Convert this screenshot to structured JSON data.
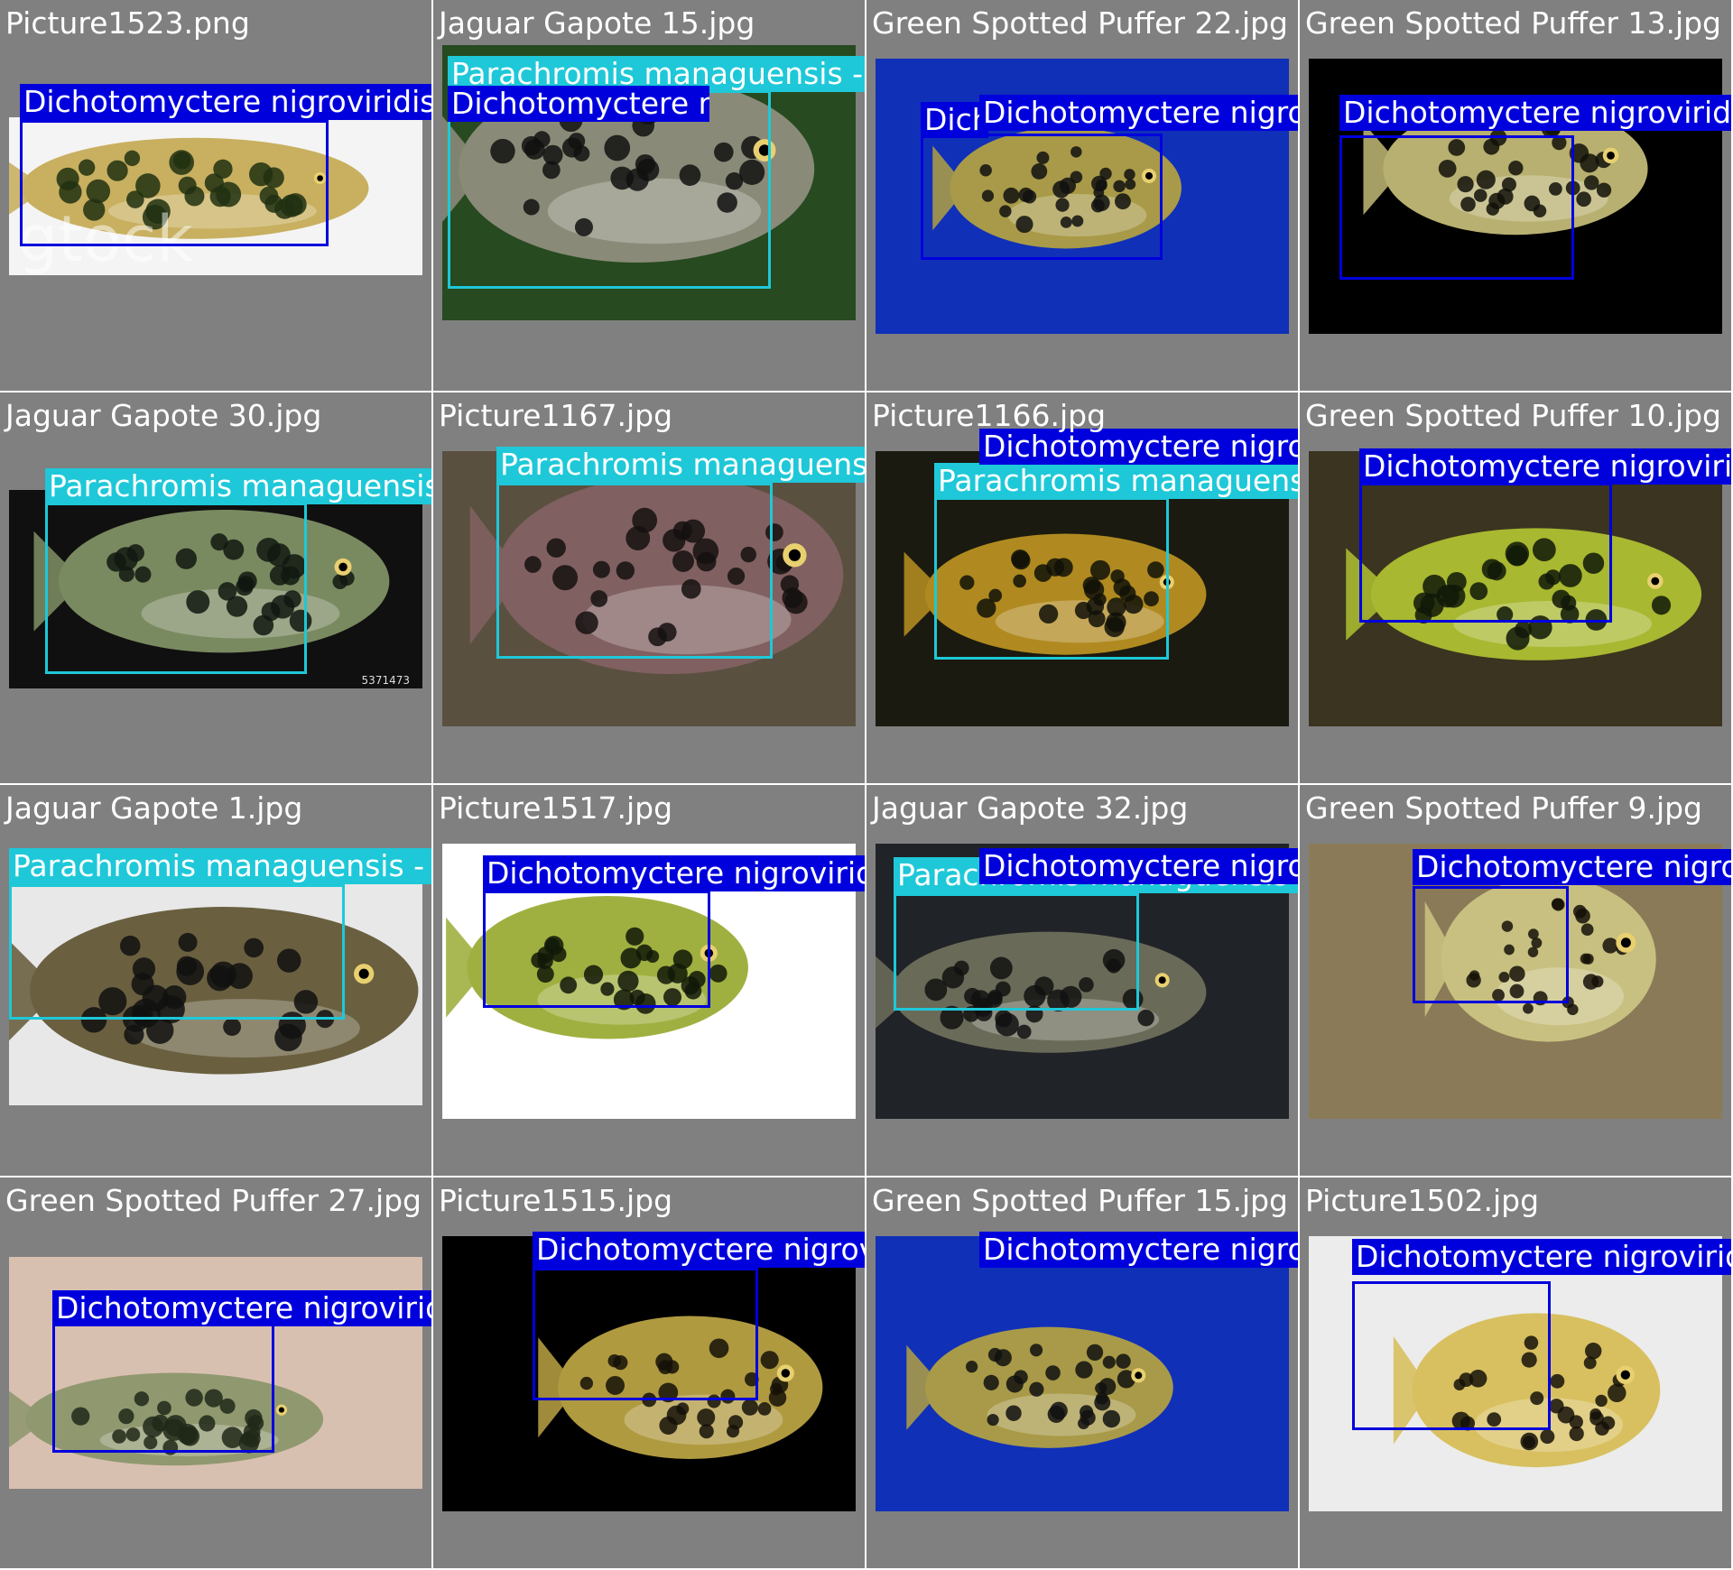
{
  "colors": {
    "grid_bg": "#808080",
    "cell_title": "#ffffff",
    "puffer": "#0000dd",
    "jaguar": "#1ec8d8",
    "label_text": "#ffffff"
  },
  "classes": {
    "puffer": "Dichotomyctere nigroviridis - Green Spotted Puffer",
    "jaguar": "Parachromis managuensis - Jaguar Guapote"
  },
  "cells": [
    {
      "title": "Picture1523.png",
      "bg": "#f4f4f4",
      "fish": "#c8b060",
      "spots": "#203010",
      "watermark": "gtock",
      "detections": [
        {
          "cls": "puffer"
        }
      ]
    },
    {
      "title": "Jaguar Gapote 15.jpg",
      "bg": "#274a20",
      "fish": "#8a8a78",
      "spots": "#101010",
      "detections": [
        {
          "cls": "jaguar"
        },
        {
          "cls": "puffer"
        }
      ]
    },
    {
      "title": "Green Spotted Puffer 22.jpg",
      "bg": "#1030b8",
      "fish": "#a89a48",
      "spots": "#101010",
      "detections": [
        {
          "cls": "puffer",
          "tag_text": "Dich"
        },
        {
          "cls": "puffer"
        }
      ]
    },
    {
      "title": "Green Spotted Puffer 13.jpg",
      "bg": "#000000",
      "fish": "#b8b070",
      "spots": "#101008",
      "detections": [
        {
          "cls": "puffer"
        }
      ]
    },
    {
      "title": "Jaguar Gapote 30.jpg",
      "bg": "#101010",
      "fish": "#7a8a60",
      "spots": "#101810",
      "watermark": "5371473",
      "detections": [
        {
          "cls": "jaguar"
        }
      ]
    },
    {
      "title": "Picture1167.jpg",
      "bg": "#5a5040",
      "fish": "#806060",
      "spots": "#151010",
      "detections": [
        {
          "cls": "jaguar"
        }
      ]
    },
    {
      "title": "Picture1166.jpg",
      "bg": "#1a1a10",
      "fish": "#b08a20",
      "spots": "#101008",
      "detections": [
        {
          "cls": "jaguar"
        },
        {
          "cls": "puffer"
        }
      ]
    },
    {
      "title": "Green Spotted Puffer 10.jpg",
      "bg": "#3a3420",
      "fish": "#a8b830",
      "spots": "#101808",
      "detections": [
        {
          "cls": "puffer"
        }
      ]
    },
    {
      "title": "Jaguar Gapote 1.jpg",
      "bg": "#e8e8e8",
      "fish": "#6a6040",
      "spots": "#101010",
      "detections": [
        {
          "cls": "jaguar"
        }
      ]
    },
    {
      "title": "Picture1517.jpg",
      "bg": "#ffffff",
      "fish": "#a0b040",
      "spots": "#101808",
      "detections": [
        {
          "cls": "puffer"
        }
      ]
    },
    {
      "title": "Jaguar Gapote 32.jpg",
      "bg": "#202428",
      "fish": "#6a6a58",
      "spots": "#101010",
      "detections": [
        {
          "cls": "jaguar"
        },
        {
          "cls": "puffer"
        }
      ]
    },
    {
      "title": "Green Spotted Puffer 9.jpg",
      "bg": "#8a7a58",
      "fish": "#c8c080",
      "spots": "#151008",
      "detections": [
        {
          "cls": "puffer"
        }
      ]
    },
    {
      "title": "Green Spotted Puffer 27.jpg",
      "bg": "#d8c0b0",
      "fish": "#909870",
      "spots": "#202818",
      "detections": [
        {
          "cls": "puffer"
        }
      ]
    },
    {
      "title": "Picture1515.jpg",
      "bg": "#000000",
      "fish": "#b09a40",
      "spots": "#151008",
      "detections": [
        {
          "cls": "puffer"
        }
      ]
    },
    {
      "title": "Green Spotted Puffer 15.jpg",
      "bg": "#1030b8",
      "fish": "#a89a48",
      "spots": "#101010",
      "detections": [
        {
          "cls": "puffer"
        },
        {
          "cls": "puffer"
        }
      ]
    },
    {
      "title": "Picture1502.jpg",
      "bg": "#ececec",
      "fish": "#d8c060",
      "spots": "#151008",
      "detections": [
        {
          "cls": "puffer"
        }
      ]
    }
  ]
}
